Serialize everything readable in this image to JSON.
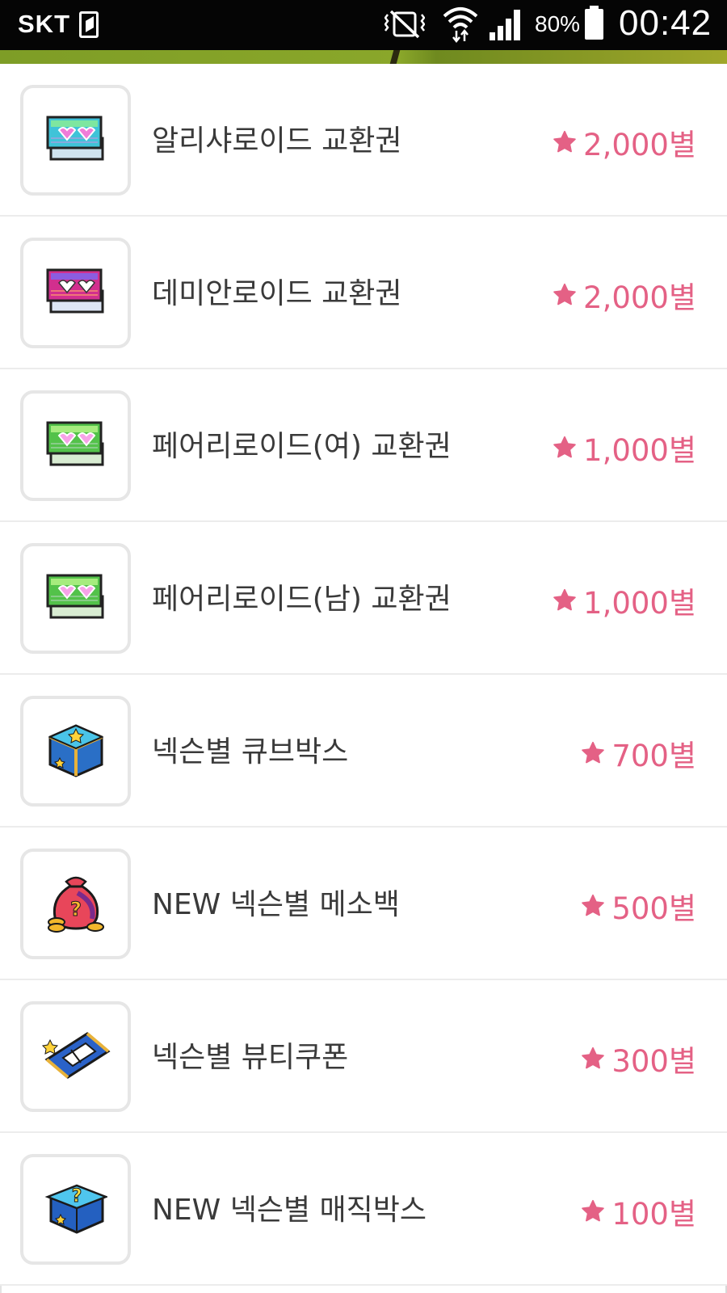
{
  "status_bar": {
    "carrier": "SKT",
    "battery": "80%",
    "time": "00:42"
  },
  "colors": {
    "price_pink": "#e46185",
    "accent_green": "#8aa72a",
    "status_bar_bg": "#050505"
  },
  "items": [
    {
      "name": "알리샤로이드 교환권",
      "price": "2,000별",
      "icon": "ticket-cyan-icon"
    },
    {
      "name": "데미안로이드 교환권",
      "price": "2,000별",
      "icon": "ticket-magenta-icon"
    },
    {
      "name": "페어리로이드(여) 교환권",
      "price": "1,000별",
      "icon": "ticket-green-icon"
    },
    {
      "name": "페어리로이드(남) 교환권",
      "price": "1,000별",
      "icon": "ticket-green-icon"
    },
    {
      "name": "넥슨별 큐브박스",
      "price": "700별",
      "icon": "cube-box-icon"
    },
    {
      "name": "NEW 넥슨별 메소백",
      "price": "500별",
      "icon": "meso-bag-icon"
    },
    {
      "name": "넥슨별 뷰티쿠폰",
      "price": "300별",
      "icon": "beauty-coupon-icon"
    },
    {
      "name": "NEW 넥슨별 매직박스",
      "price": "100별",
      "icon": "magic-box-icon"
    }
  ]
}
